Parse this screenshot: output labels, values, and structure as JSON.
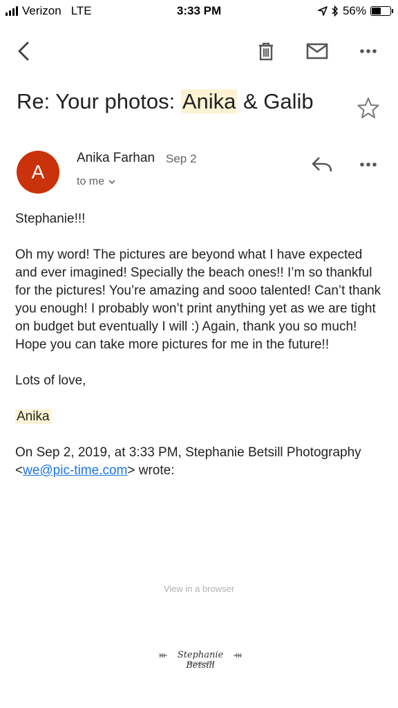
{
  "status_bar": {
    "carrier": "Verizon",
    "network": "LTE",
    "time": "3:33 PM",
    "battery_percent": "56%",
    "battery_level": 0.56
  },
  "toolbar": {
    "back_icon": "chevron-left-icon",
    "delete_icon": "trash-icon",
    "mark_unread_icon": "mail-icon",
    "more_icon": "more-horizontal-icon"
  },
  "email": {
    "subject_prefix": "Re: Your photos: ",
    "subject_highlight": "Anika",
    "subject_suffix": " & Galib",
    "sender_name": "Anika Farhan",
    "sender_initial": "A",
    "date": "Sep 2",
    "recipient": "to me",
    "avatar_color": "#c9320a",
    "highlight_color": "#fdf3d4",
    "body": {
      "greeting": "Stephanie!!!",
      "paragraph": "Oh my word! The pictures are beyond what I have expected and ever imagined! Specially the beach ones!! I’m so thankful for the pictures! You’re amazing and sooo talented! Can’t thank you enough! I probably won’t print anything yet as we are tight on budget but eventually I will :) Again, thank you so much! Hope you can take more pictures for me in the future!!",
      "closing": "Lots of love,",
      "signature": "Anika",
      "quote_prefix": "On Sep 2, 2019, at 3:33 PM, Stephanie Betsill Photography <",
      "quote_email": "we@pic-time.com",
      "quote_suffix": "> wrote:"
    }
  },
  "footer": {
    "view_in_browser": "View in a browser",
    "logo_text": "Stephanie Betsill",
    "logo_subtext": "photography"
  }
}
